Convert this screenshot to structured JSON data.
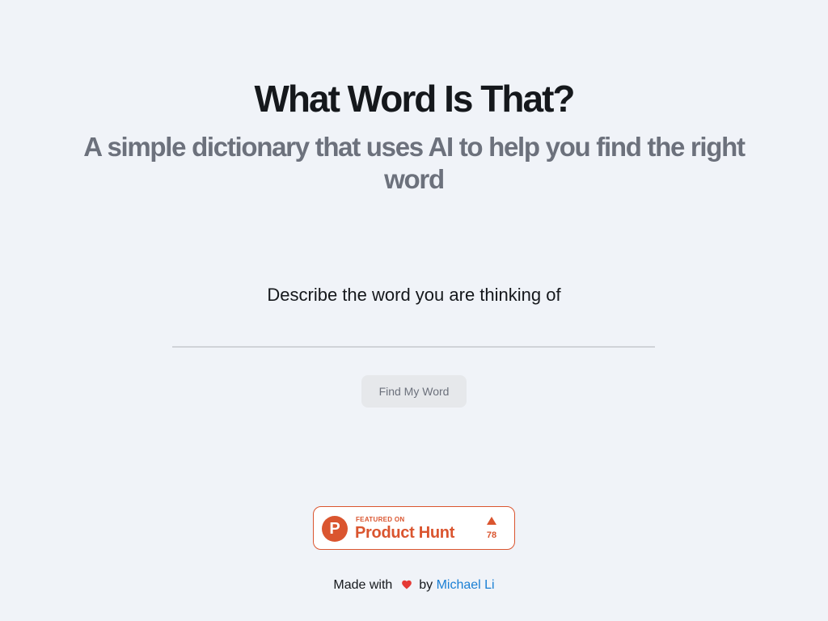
{
  "header": {
    "title": "What Word Is That?",
    "subtitle": "A simple dictionary that uses AI to help you find the right word"
  },
  "search": {
    "prompt": "Describe the word you are thinking of",
    "value": "",
    "placeholder": "",
    "button_label": "Find My Word"
  },
  "badge": {
    "logo_letter": "P",
    "featured_on": "FEATURED ON",
    "name": "Product Hunt",
    "upvotes": "78",
    "icon": "upvote-triangle-icon",
    "color": "#da552f"
  },
  "footer": {
    "made_with": "Made with",
    "heart_icon": "heart-icon",
    "by": "by",
    "author": "Michael Li"
  },
  "colors": {
    "background": "#f0f3f8",
    "title": "#15181c",
    "subtitle": "#6c717c",
    "link": "#1a7fd4",
    "heart": "#e53935"
  }
}
